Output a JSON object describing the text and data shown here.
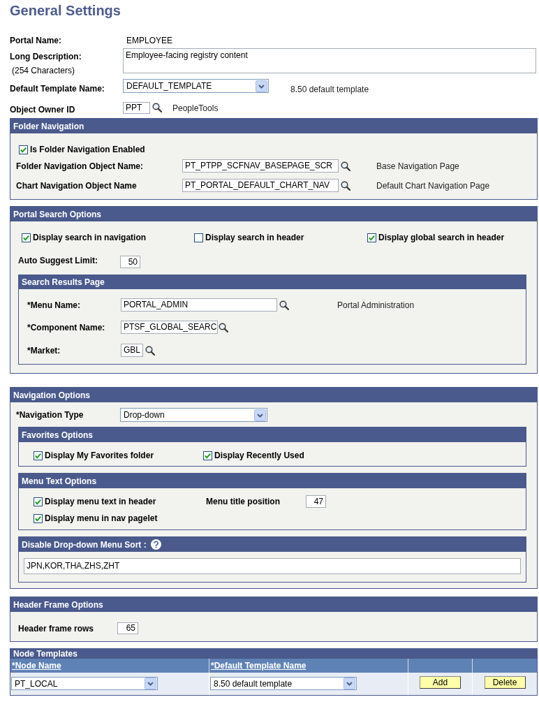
{
  "page_title": "General Settings",
  "general": {
    "portal_name": {
      "label": "Portal Name:",
      "value": "EMPLOYEE"
    },
    "long_description": {
      "label": "Long Description:",
      "note": "(254 Characters)",
      "value": "Employee-facing registry content"
    },
    "default_template": {
      "label": "Default Template Name:",
      "value": "DEFAULT_TEMPLATE",
      "description": "8.50 default template"
    },
    "object_owner": {
      "label": "Object Owner ID",
      "value": "PPT",
      "description": "PeopleTools"
    }
  },
  "folder_navigation": {
    "title": "Folder Navigation",
    "enabled": {
      "label": "Is Folder Navigation Enabled",
      "checked": true
    },
    "fields": [
      {
        "label": "Folder Navigation Object Name:",
        "value": "PT_PTPP_SCFNAV_BASEPAGE_SCR",
        "description": "Base Navigation Page"
      },
      {
        "label": "Chart Navigation Object Name",
        "value": "PT_PORTAL_DEFAULT_CHART_NAV",
        "description": "Default Chart Navigation Page"
      }
    ]
  },
  "portal_search": {
    "title": "Portal Search Options",
    "checkboxes": [
      {
        "label": "Display search in navigation",
        "checked": true
      },
      {
        "label": "Display search in header",
        "checked": false
      },
      {
        "label": "Display global search in header",
        "checked": true
      }
    ],
    "auto_suggest_limit": {
      "label": "Auto Suggest Limit:",
      "value": "50"
    },
    "search_results_page": {
      "title": "Search Results Page",
      "fields": [
        {
          "label": "*Menu Name:",
          "value": "PORTAL_ADMIN",
          "description": "Portal Administration"
        },
        {
          "label": "*Component Name:",
          "value": "PTSF_GLOBAL_SEARC"
        },
        {
          "label": "*Market:",
          "value": "GBL"
        }
      ]
    }
  },
  "navigation_options": {
    "title": "Navigation Options",
    "navigation_type": {
      "label": "*Navigation Type",
      "value": "Drop-down"
    },
    "favorites_options": {
      "title": "Favorites Options",
      "checkboxes": [
        {
          "label": "Display My Favorites folder",
          "checked": true
        },
        {
          "label": "Display Recently Used",
          "checked": true
        }
      ]
    },
    "menu_text_options": {
      "title": "Menu Text Options",
      "checkboxes": [
        {
          "label": "Display menu text in header",
          "checked": true
        },
        {
          "label": "Display menu in nav pagelet",
          "checked": true
        }
      ],
      "menu_title_position": {
        "label": "Menu title position",
        "value": "47"
      }
    },
    "disable_menu_sort": {
      "title": "Disable Drop-down Menu Sort :",
      "value": "JPN,KOR,THA,ZHS,ZHT"
    }
  },
  "header_frame_options": {
    "title": "Header Frame Options",
    "header_frame_rows": {
      "label": "Header frame rows",
      "value": "65"
    }
  },
  "node_templates": {
    "title": "Node Templates",
    "columns": [
      "*Node Name",
      "*Default Template Name"
    ],
    "rows": [
      {
        "node_name": "PT_LOCAL",
        "default_template": "8.50 default template",
        "buttons": [
          "Add",
          "Delete"
        ]
      }
    ]
  }
}
